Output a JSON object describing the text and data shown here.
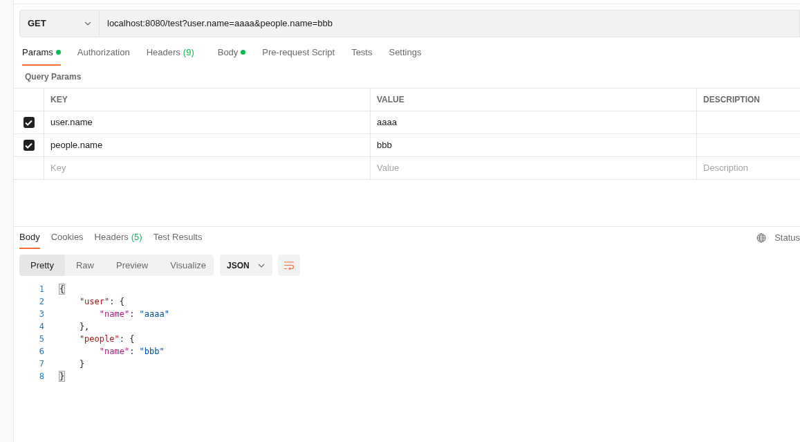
{
  "request": {
    "method": "GET",
    "url": "localhost:8080/test?user.name=aaaa&people.name=bbb"
  },
  "request_tabs": [
    {
      "label": "Params",
      "dot": true,
      "selected": true
    },
    {
      "label": "Authorization",
      "dot": false,
      "selected": false
    },
    {
      "label": "Headers",
      "count": "(9)",
      "dot": false,
      "selected": false
    },
    {
      "label": "Body",
      "dot": true,
      "selected": false
    },
    {
      "label": "Pre-request Script",
      "dot": false,
      "selected": false
    },
    {
      "label": "Tests",
      "dot": false,
      "selected": false
    },
    {
      "label": "Settings",
      "dot": false,
      "selected": false
    }
  ],
  "params_title": "Query Params",
  "params_table": {
    "columns": [
      "KEY",
      "VALUE",
      "DESCRIPTION"
    ],
    "rows": [
      {
        "checked": true,
        "key": "user.name",
        "value": "aaaa"
      },
      {
        "checked": true,
        "key": "people.name",
        "value": "bbb"
      }
    ],
    "new_row": {
      "key_placeholder": "Key",
      "value_placeholder": "Value",
      "description_placeholder": "Description"
    }
  },
  "response_tabs": [
    {
      "label": "Body",
      "selected": true
    },
    {
      "label": "Cookies",
      "selected": false
    },
    {
      "label": "Headers",
      "count": "(5)",
      "selected": false
    },
    {
      "label": "Test Results",
      "selected": false
    }
  ],
  "status_label": "Status",
  "view_modes": [
    {
      "label": "Pretty",
      "selected": true
    },
    {
      "label": "Raw",
      "selected": false
    },
    {
      "label": "Preview",
      "selected": false
    },
    {
      "label": "Visualize",
      "selected": false
    }
  ],
  "format": "JSON",
  "code_lines": [
    {
      "number": "1",
      "tokens": [
        {
          "kind": "match",
          "text": "{"
        }
      ]
    },
    {
      "number": "2",
      "tokens": [
        {
          "kind": "key",
          "text": "    \"user\""
        },
        {
          "kind": "punct",
          "text": ": {"
        }
      ]
    },
    {
      "number": "3",
      "tokens": [
        {
          "kind": "subkey",
          "text": "        \"name\""
        },
        {
          "kind": "punct",
          "text": ": "
        },
        {
          "kind": "string",
          "text": "\"aaaa\""
        }
      ]
    },
    {
      "number": "4",
      "tokens": [
        {
          "kind": "punct",
          "text": "    },"
        }
      ]
    },
    {
      "number": "5",
      "tokens": [
        {
          "kind": "key",
          "text": "    \"people\""
        },
        {
          "kind": "punct",
          "text": ": {"
        }
      ]
    },
    {
      "number": "6",
      "tokens": [
        {
          "kind": "subkey",
          "text": "        \"name\""
        },
        {
          "kind": "punct",
          "text": ": "
        },
        {
          "kind": "string",
          "text": "\"bbb\""
        }
      ]
    },
    {
      "number": "7",
      "tokens": [
        {
          "kind": "punct",
          "text": "    }"
        }
      ]
    },
    {
      "number": "8",
      "tokens": [
        {
          "kind": "match",
          "text": "}"
        }
      ]
    }
  ]
}
